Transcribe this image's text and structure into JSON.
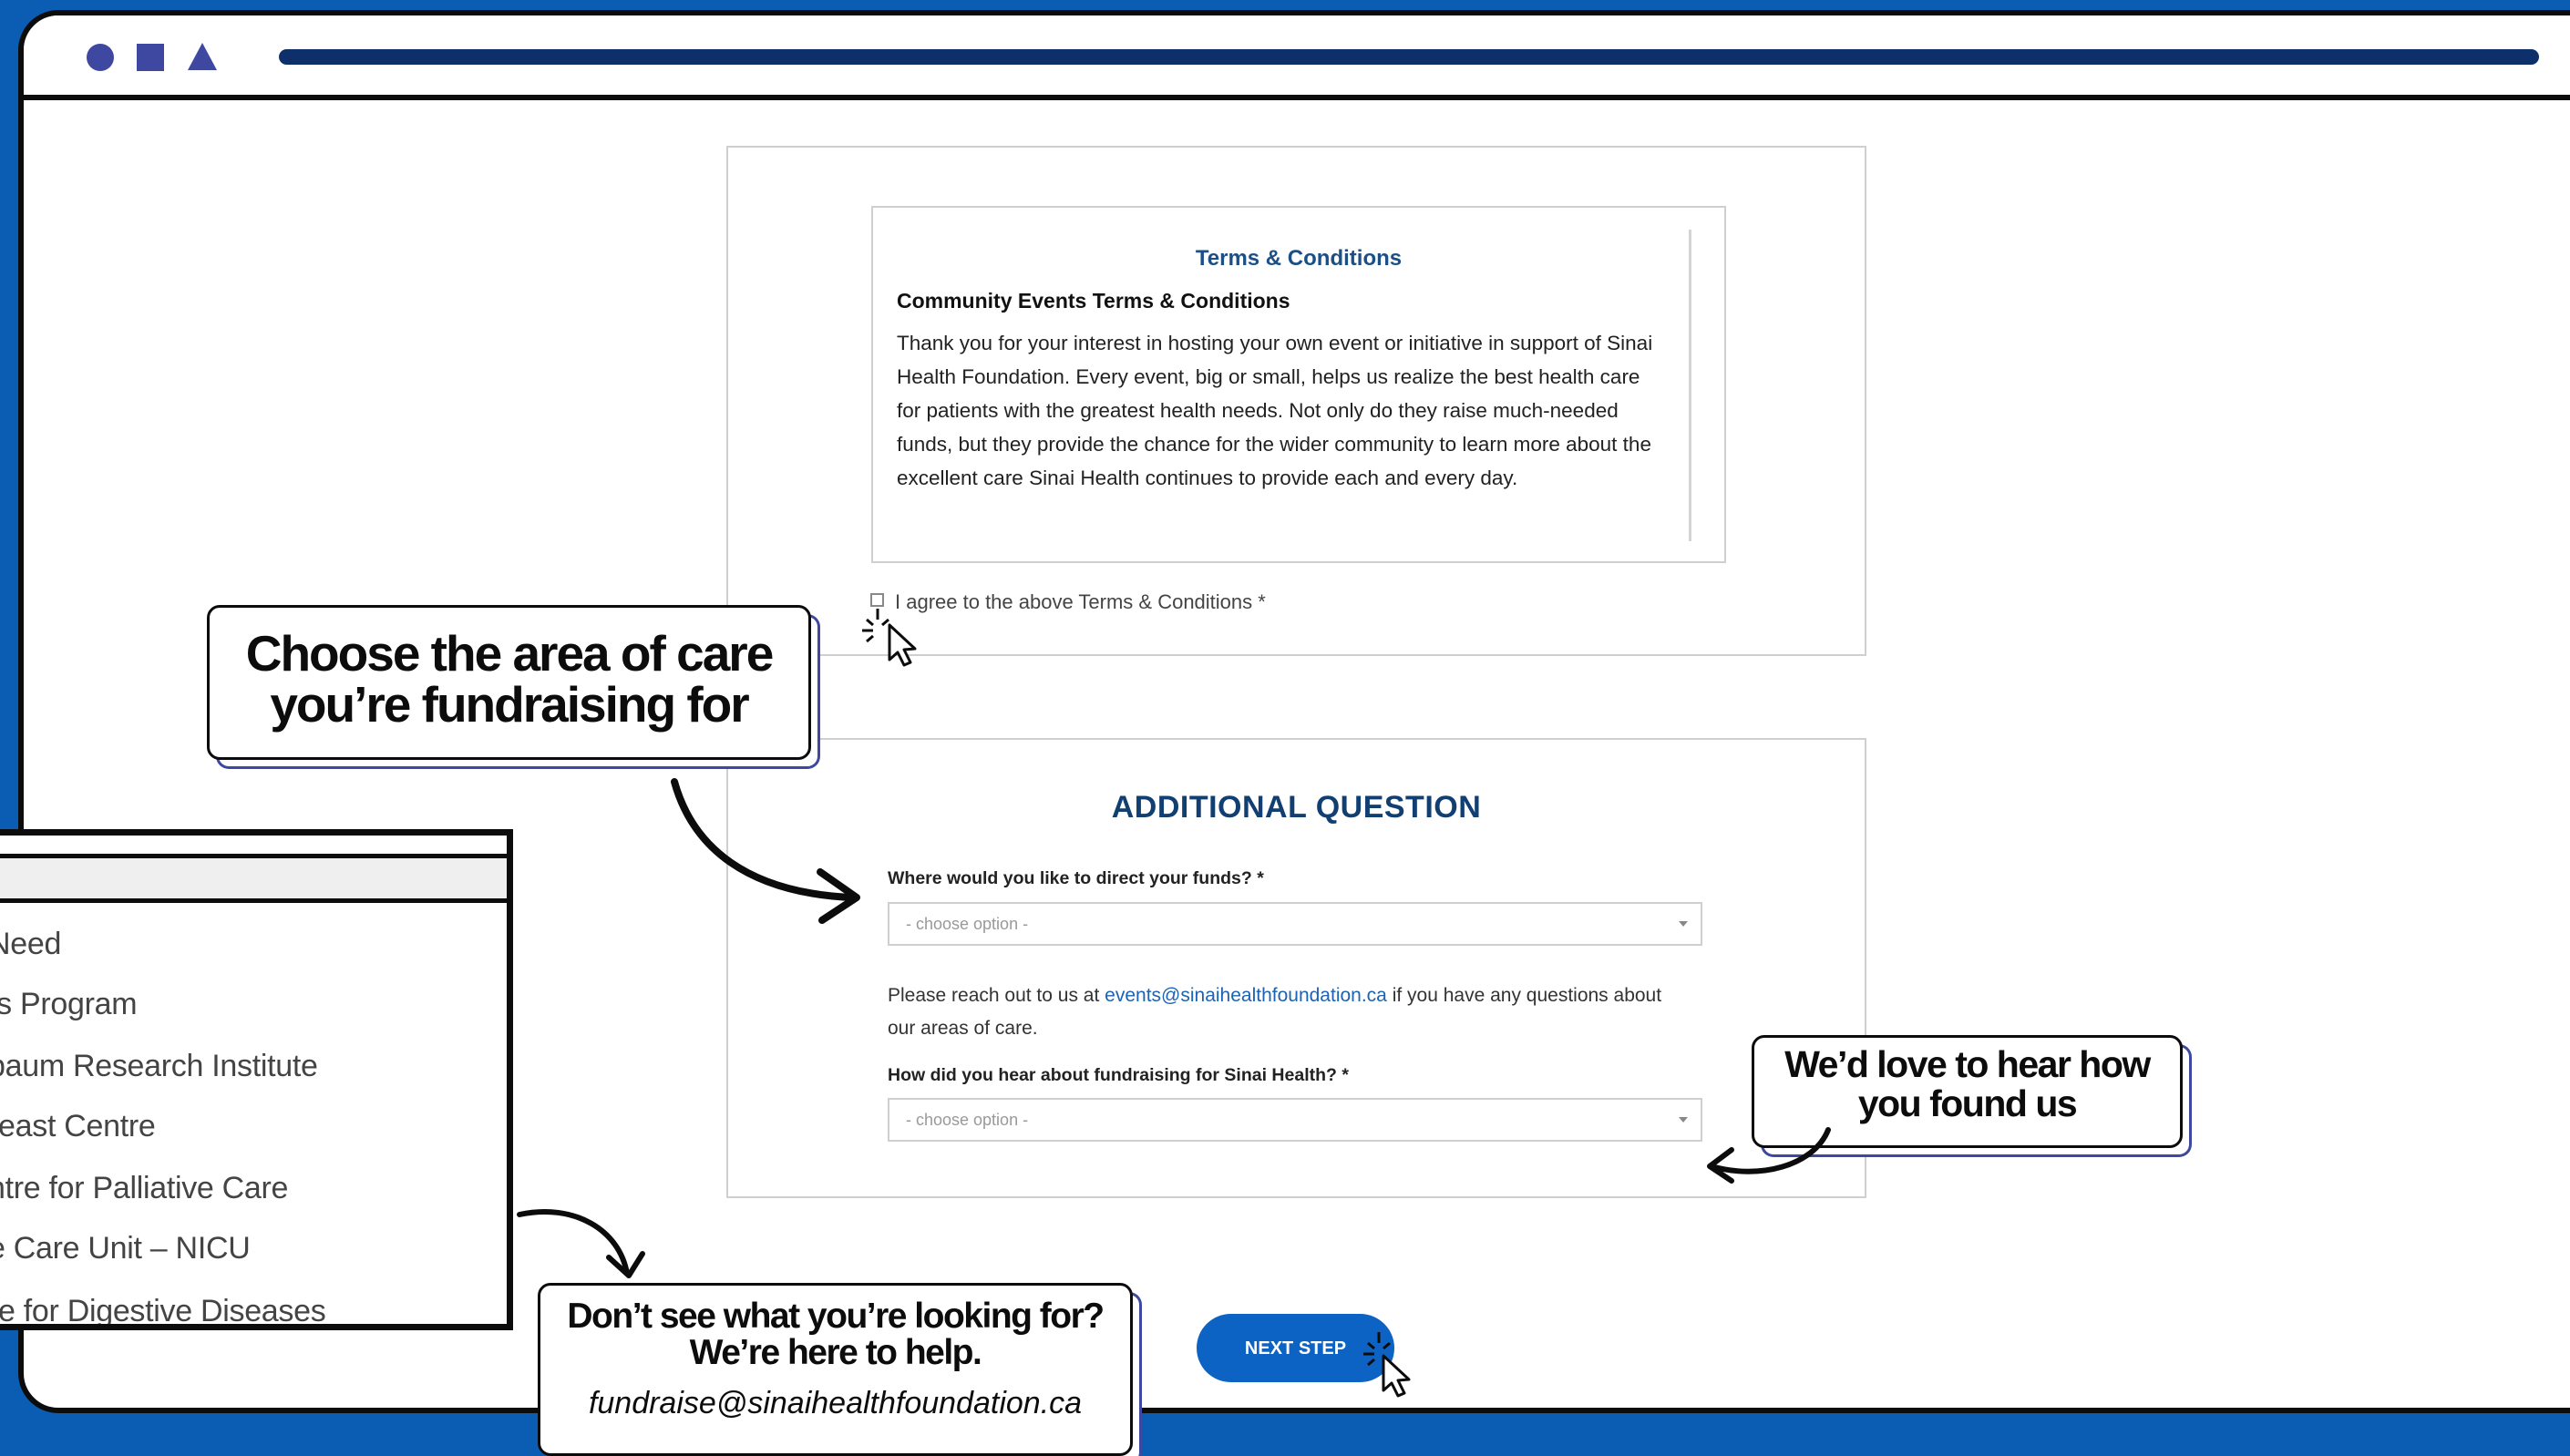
{
  "terms": {
    "title": "Terms & Conditions",
    "subtitle": "Community Events Terms & Conditions",
    "body": " Thank you for your interest in hosting your own event or initiative in support of Sinai Health Foundation. Every event, big or small, helps us realize the best health care for patients with the greatest health needs. Not only do they raise much-needed funds, but they provide the chance for the wider community to learn more about the excellent care Sinai Health continues to provide each and every day.",
    "agree_label": "I agree to the above Terms & Conditions *"
  },
  "question": {
    "heading": "ADDITIONAL QUESTION",
    "funds_label": "Where would you like to direct your funds? *",
    "funds_placeholder": "- choose option -",
    "note_prefix": "Please reach out to us at ",
    "note_email": "events@sinaihealthfoundation.ca",
    "note_suffix": " if you have any questions about our areas of care.",
    "hear_label": "How did you hear about fundraising for Sinai Health? *",
    "hear_placeholder": "- choose option -"
  },
  "next_button": "NEXT STEP",
  "dropdown": {
    "items": [
      "Need",
      "ts Program",
      "baum Research Institute",
      "reast Centre",
      "ntre for Palliative Care",
      "e Care Unit – NICU",
      "re for Digestive Diseases"
    ]
  },
  "callouts": {
    "area_line1": "Choose the area of care",
    "area_line2": "you’re fundraising for",
    "found_line1": "We’d love to hear how",
    "found_line2": "you found us",
    "help_line1": "Don’t see what you’re looking for?",
    "help_line2": "We’re here to help.",
    "help_email": "fundraise@sinaihealthfoundation.ca"
  },
  "colors": {
    "background": "#0a5db3",
    "brand_navy": "#123f72",
    "button": "#0d63c3",
    "accent": "#3f48a0"
  },
  "icons": [
    "circle-icon",
    "square-icon",
    "triangle-icon",
    "click-cursor-icon",
    "curved-arrow-icon"
  ]
}
